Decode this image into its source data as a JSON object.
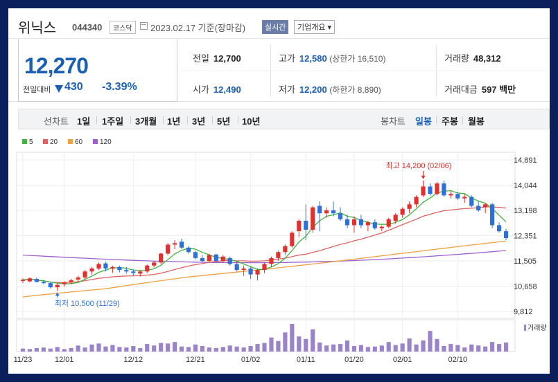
{
  "header": {
    "name": "위닉스",
    "code": "044340",
    "market": "코스닥",
    "date": "2023.02.17 기준(장마감)",
    "live_label": "실시간",
    "info_label": "기업개요 ▾"
  },
  "quote": {
    "price": "12,270",
    "change_label": "전일대비",
    "change_value": "430",
    "change_pct": "-3.39%",
    "prev_close_label": "전일",
    "prev_close": "12,700",
    "high_label": "고가",
    "high": "12,580",
    "upper_limit": "(상한가 16,510)",
    "volume_label": "거래량",
    "volume": "48,312",
    "open_label": "시가",
    "open": "12,490",
    "low_label": "저가",
    "low": "12,200",
    "lower_limit": "(하한가 8,890)",
    "turnover_label": "거래대금",
    "turnover": "597 백만"
  },
  "tabs": {
    "line_label": "선차트",
    "periods": [
      "1일",
      "1주일",
      "3개월",
      "1년",
      "3년",
      "5년",
      "10년"
    ],
    "candle_label": "봉차트",
    "candles": [
      "일봉",
      "주봉",
      "월봉"
    ],
    "active_candle": "일봉"
  },
  "colors": {
    "up": "#e0312f",
    "down": "#2f6fd8",
    "ma5": "#3fb53f",
    "ma20": "#e06060",
    "ma60": "#f0a040",
    "ma120": "#9d5fd0",
    "volume": "#9b83c9"
  },
  "chart_data": {
    "type": "candlestick",
    "legend": [
      {
        "name": "5",
        "color": "#3fb53f"
      },
      {
        "name": "20",
        "color": "#e06060"
      },
      {
        "name": "60",
        "color": "#f0a040"
      },
      {
        "name": "120",
        "color": "#9d5fd0"
      }
    ],
    "y_ticks": [
      "14,891",
      "14,044",
      "13,198",
      "12,351",
      "11,505",
      "10,658",
      "9,812"
    ],
    "ylim": [
      9812,
      14891
    ],
    "x_ticks": [
      "11/23",
      "12/01",
      "12/12",
      "12/21",
      "01/02",
      "01/11",
      "01/20",
      "02/01",
      "02/10"
    ],
    "high_annotation": "최고 14,200 (02/06)",
    "low_annotation": "최저 10,500 (11/29)",
    "volume_label": "거래량",
    "candles": [
      [
        10830,
        10920,
        10760,
        10870
      ],
      [
        10820,
        10960,
        10780,
        10920
      ],
      [
        10900,
        10950,
        10780,
        10800
      ],
      [
        10800,
        10870,
        10720,
        10760
      ],
      [
        10760,
        10800,
        10580,
        10620
      ],
      [
        10620,
        10760,
        10500,
        10700
      ],
      [
        10720,
        10820,
        10650,
        10780
      ],
      [
        10800,
        10900,
        10720,
        10860
      ],
      [
        10880,
        11000,
        10800,
        10950
      ],
      [
        10950,
        11200,
        10900,
        11150
      ],
      [
        11150,
        11300,
        11050,
        11250
      ],
      [
        11250,
        11450,
        11200,
        11400
      ],
      [
        11420,
        11480,
        11150,
        11250
      ],
      [
        11250,
        11350,
        11100,
        11300
      ],
      [
        11300,
        11350,
        11120,
        11200
      ],
      [
        11200,
        11300,
        11080,
        11150
      ],
      [
        11150,
        11220,
        11020,
        11100
      ],
      [
        11080,
        11200,
        10980,
        11150
      ],
      [
        11150,
        11380,
        11100,
        11350
      ],
      [
        11350,
        11500,
        11280,
        11450
      ],
      [
        11450,
        11780,
        11400,
        11750
      ],
      [
        11750,
        12100,
        11700,
        12050
      ],
      [
        12050,
        12200,
        11900,
        12100
      ],
      [
        12150,
        12250,
        11900,
        11950
      ],
      [
        11950,
        12000,
        11750,
        11800
      ],
      [
        11800,
        11850,
        11550,
        11600
      ],
      [
        11600,
        11700,
        11450,
        11500
      ],
      [
        11500,
        11750,
        11450,
        11700
      ],
      [
        11720,
        11750,
        11450,
        11500
      ],
      [
        11500,
        11700,
        11450,
        11650
      ],
      [
        11600,
        11650,
        11350,
        11400
      ],
      [
        11400,
        11500,
        11150,
        11200
      ],
      [
        11200,
        11350,
        11000,
        11250
      ],
      [
        11250,
        11300,
        10900,
        11050
      ],
      [
        11050,
        11250,
        10850,
        11200
      ],
      [
        11200,
        11450,
        11100,
        11400
      ],
      [
        11400,
        11650,
        11300,
        11600
      ],
      [
        11600,
        11850,
        11500,
        11800
      ],
      [
        11800,
        12050,
        11700,
        12000
      ],
      [
        12000,
        12500,
        11950,
        12450
      ],
      [
        12500,
        12900,
        12300,
        12850
      ],
      [
        12850,
        13400,
        12200,
        12550
      ],
      [
        12550,
        13350,
        12450,
        13300
      ],
      [
        13350,
        13500,
        12500,
        13100
      ],
      [
        13100,
        13300,
        12950,
        13200
      ],
      [
        13200,
        13500,
        13000,
        13100
      ],
      [
        13100,
        13300,
        12850,
        12900
      ],
      [
        12900,
        13050,
        12600,
        12700
      ],
      [
        12700,
        13000,
        12450,
        12900
      ],
      [
        12900,
        13050,
        12600,
        12700
      ],
      [
        12700,
        12850,
        12500,
        12800
      ],
      [
        12800,
        12900,
        12550,
        12600
      ],
      [
        12600,
        12700,
        12500,
        12650
      ],
      [
        12650,
        12950,
        12600,
        12900
      ],
      [
        12850,
        13100,
        12750,
        13050
      ],
      [
        13050,
        13300,
        12950,
        13250
      ],
      [
        13250,
        13500,
        13100,
        13400
      ],
      [
        13400,
        13700,
        13300,
        13650
      ],
      [
        13700,
        14200,
        13650,
        14000
      ],
      [
        14000,
        14100,
        13700,
        13750
      ],
      [
        13750,
        14150,
        13700,
        14100
      ],
      [
        14100,
        14200,
        13650,
        13700
      ],
      [
        13700,
        13850,
        13600,
        13750
      ],
      [
        13750,
        13800,
        13550,
        13600
      ],
      [
        13600,
        13750,
        13450,
        13650
      ],
      [
        13650,
        13700,
        13300,
        13350
      ],
      [
        13350,
        13500,
        13150,
        13200
      ],
      [
        13300,
        13450,
        13100,
        13400
      ],
      [
        13400,
        13450,
        12600,
        12700
      ],
      [
        12700,
        12800,
        12450,
        12500
      ],
      [
        12500,
        12580,
        12200,
        12270
      ]
    ],
    "volumes": [
      6,
      5,
      7,
      8,
      6,
      9,
      5,
      7,
      12,
      8,
      14,
      16,
      10,
      13,
      9,
      8,
      11,
      7,
      15,
      12,
      17,
      16,
      19,
      10,
      9,
      14,
      11,
      8,
      7,
      9,
      12,
      10,
      8,
      11,
      15,
      17,
      28,
      21,
      38,
      55,
      30,
      25,
      44,
      18,
      12,
      14,
      15,
      22,
      11,
      13,
      9,
      10,
      12,
      19,
      13,
      16,
      26,
      14,
      22,
      41,
      25,
      11,
      15,
      13,
      8,
      14,
      12,
      10,
      19,
      15,
      18
    ]
  }
}
